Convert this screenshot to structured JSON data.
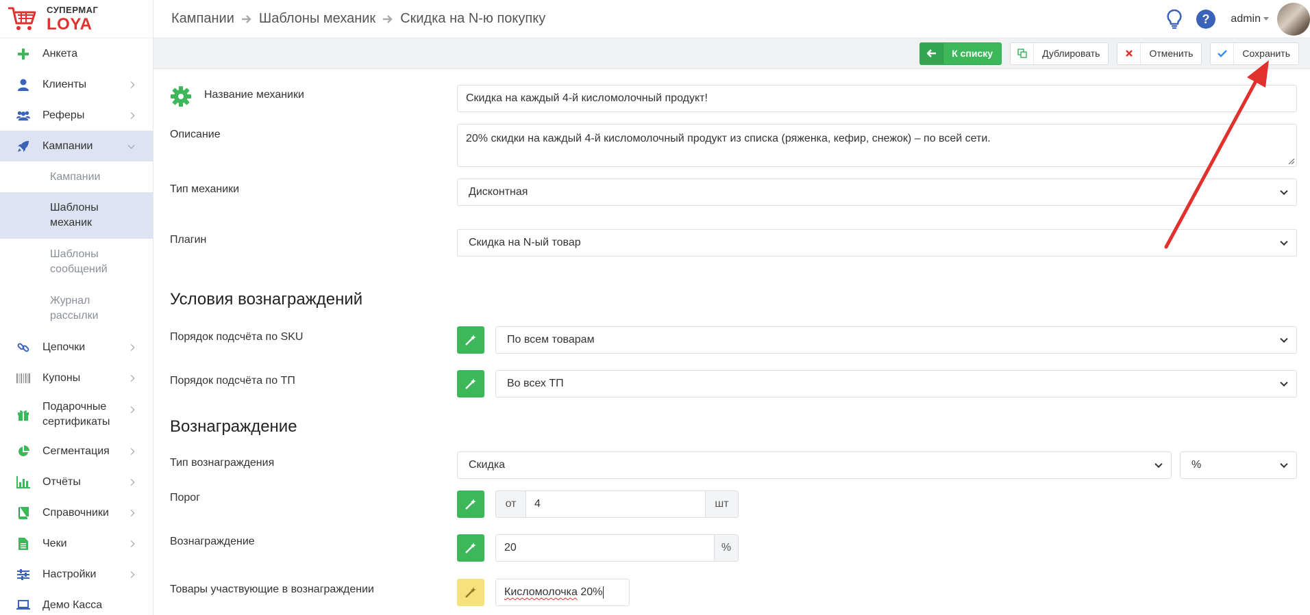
{
  "brand": {
    "top": "СУПЕРМАГ",
    "bottom": "LOYA"
  },
  "sidebar": {
    "items": [
      {
        "label": "Анкета",
        "icon": "plus-icon"
      },
      {
        "label": "Клиенты",
        "icon": "user-icon"
      },
      {
        "label": "Реферы",
        "icon": "users-icon"
      },
      {
        "label": "Кампании",
        "icon": "rocket-icon",
        "expanded": true
      },
      {
        "label": "Цепочки",
        "icon": "link-icon"
      },
      {
        "label": "Купоны",
        "icon": "barcode-icon"
      },
      {
        "label": "Подарочные сертификаты",
        "icon": "gift-icon"
      },
      {
        "label": "Сегментация",
        "icon": "pie-icon"
      },
      {
        "label": "Отчёты",
        "icon": "bar-chart-icon"
      },
      {
        "label": "Справочники",
        "icon": "book-icon"
      },
      {
        "label": "Чеки",
        "icon": "receipt-icon"
      },
      {
        "label": "Настройки",
        "icon": "sliders-icon"
      },
      {
        "label": "Демо Касса",
        "icon": "laptop-icon"
      }
    ],
    "subitems": [
      {
        "label": "Кампании"
      },
      {
        "label": "Шаблоны механик",
        "active": true
      },
      {
        "label": "Шаблоны сообщений"
      },
      {
        "label": "Журнал рассылки"
      }
    ]
  },
  "header": {
    "breadcrumbs": [
      "Кампании",
      "Шаблоны механик",
      "Скидка на N-ю покупку"
    ],
    "user": "admin"
  },
  "toolbar": {
    "back": "К списку",
    "duplicate": "Дублировать",
    "cancel": "Отменить",
    "save": "Сохранить"
  },
  "form": {
    "name_label": "Название механики",
    "name_value": "Скидка на каждый 4-й кисломолочный продукт!",
    "description_label": "Описание",
    "description_value": "20% скидки на каждый 4-й кисломолочный продукт из списка (ряженка, кефир, снежок) – по всей сети.",
    "type_label": "Тип механики",
    "type_value": "Дисконтная",
    "plugin_label": "Плагин",
    "plugin_value": "Скидка на N-ый товар",
    "conditions_title": "Условия вознаграждений",
    "sku_label": "Порядок подсчёта по SKU",
    "sku_value": "По всем товарам",
    "tp_label": "Порядок подсчёта по ТП",
    "tp_value": "Во всех ТП",
    "reward_title": "Вознаграждение",
    "reward_type_label": "Тип вознаграждения",
    "reward_type_value": "Скидка",
    "reward_unit_value": "%",
    "threshold_label": "Порог",
    "threshold_prefix": "от",
    "threshold_value": "4",
    "threshold_suffix": "шт",
    "reward_label": "Вознаграждение",
    "reward_value": "20",
    "reward_suffix": "%",
    "goods_label": "Товары участвующие в вознаграждении",
    "goods_value_underlined": "Кисломолочка",
    "goods_value_rest": " 20%"
  },
  "colors": {
    "accent_green": "#3cb85a",
    "brand_red": "#e2302c",
    "active_nav": "#dde3f2",
    "annotation_arrow": "#e2302c"
  }
}
